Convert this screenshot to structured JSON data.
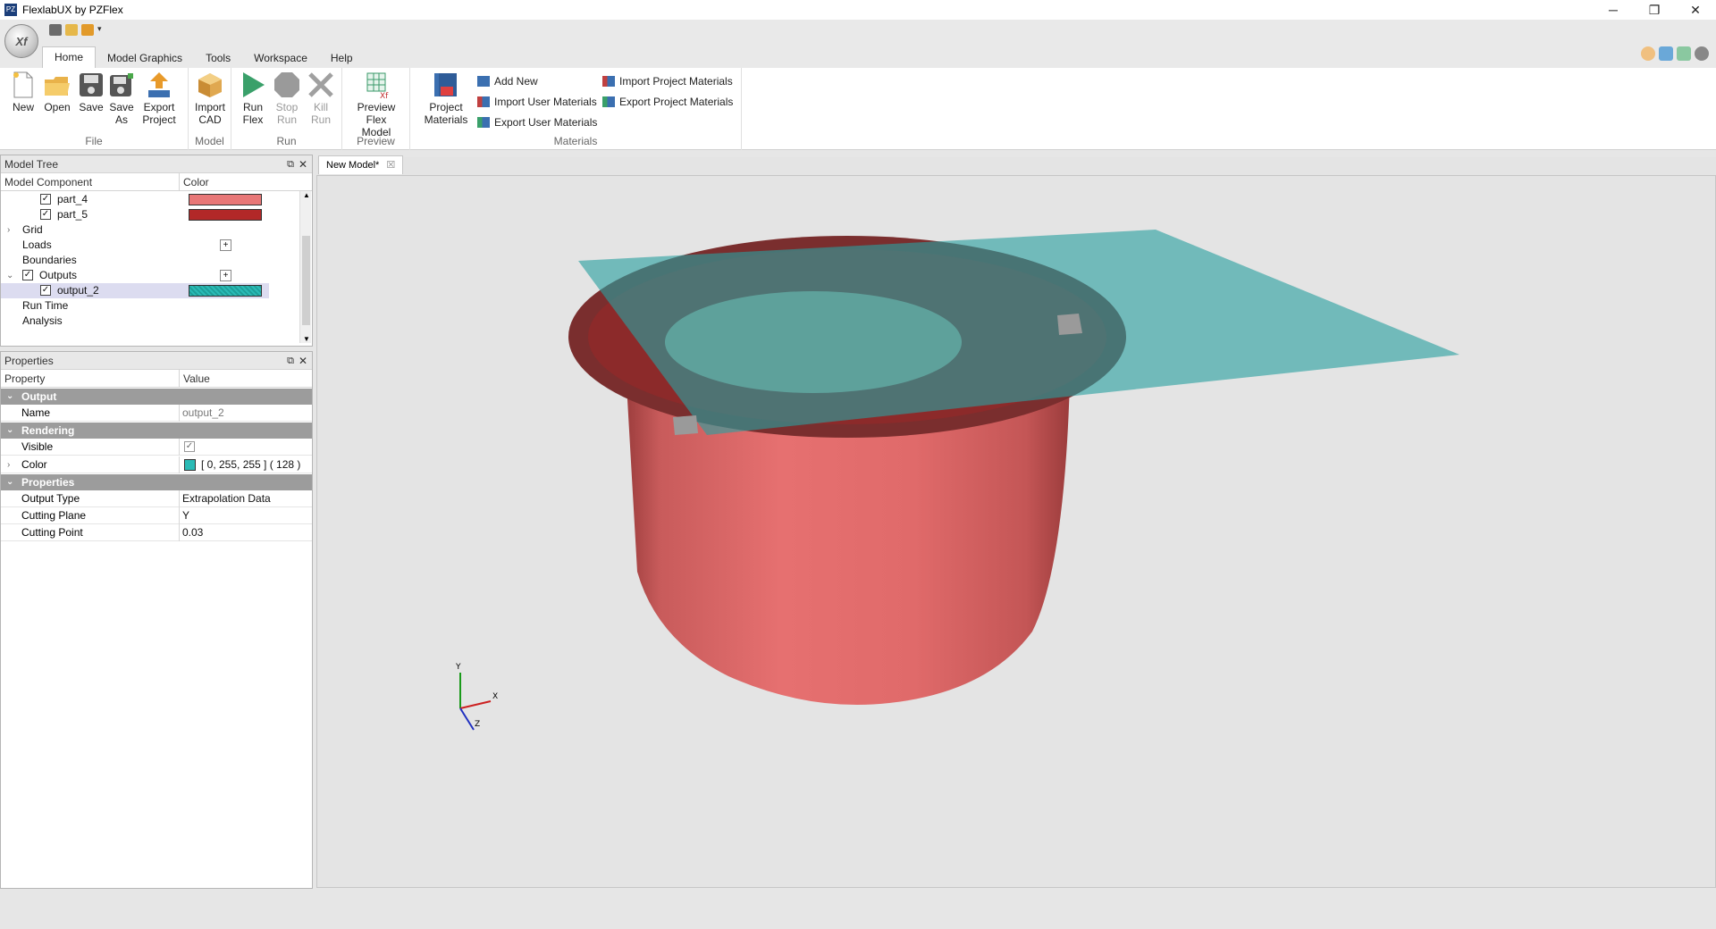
{
  "window": {
    "title": "FlexlabUX by PZFlex",
    "app_icon": "app-icon",
    "minimize": "─",
    "maximize": "❐",
    "close": "✕"
  },
  "app_button_label": "Xf",
  "menu_tabs": [
    "Home",
    "Model Graphics",
    "Tools",
    "Workspace",
    "Help"
  ],
  "active_tab": "Home",
  "ribbon": {
    "file": {
      "label": "File",
      "new": "New",
      "open": "Open",
      "save": "Save",
      "save_as_1": "Save",
      "save_as_2": "As",
      "export_1": "Export",
      "export_2": "Project"
    },
    "model": {
      "label": "Model",
      "import_1": "Import",
      "import_2": "CAD"
    },
    "run": {
      "label": "Run",
      "run_1": "Run",
      "run_2": "Flex",
      "stop_1": "Stop",
      "stop_2": "Run",
      "kill_1": "Kill",
      "kill_2": "Run"
    },
    "preview": {
      "label": "Preview",
      "preview_1": "Preview Flex",
      "preview_2": "Model"
    },
    "materials": {
      "label": "Materials",
      "project_1": "Project",
      "project_2": "Materials",
      "add_new": "Add New",
      "import_user": "Import User Materials",
      "export_user": "Export User Materials",
      "import_project": "Import Project Materials",
      "export_project": "Export Project Materials"
    }
  },
  "model_tree": {
    "title": "Model Tree",
    "col_component": "Model Component",
    "col_color": "Color",
    "items": [
      {
        "label": "part_4",
        "color": "#e87777"
      },
      {
        "label": "part_5",
        "color": "#b22828"
      },
      {
        "label": "Grid"
      },
      {
        "label": "Loads",
        "plus": "+"
      },
      {
        "label": "Boundaries"
      },
      {
        "label": "Outputs",
        "plus": "+"
      },
      {
        "label": "output_2",
        "color": "#2abbb6"
      },
      {
        "label": "Run Time"
      },
      {
        "label": "Analysis"
      }
    ]
  },
  "properties": {
    "title": "Properties",
    "col_property": "Property",
    "col_value": "Value",
    "sections": {
      "output": "Output",
      "rendering": "Rendering",
      "properties": "Properties"
    },
    "rows": {
      "name": {
        "label": "Name",
        "value": "output_2"
      },
      "visible": {
        "label": "Visible",
        "value": "✓"
      },
      "color": {
        "label": "Color",
        "value": "[ 0, 255, 255 ] ( 128 )",
        "swatch": "#2abbb6"
      },
      "output_type": {
        "label": "Output Type",
        "value": "Extrapolation Data"
      },
      "cutting_plane": {
        "label": "Cutting Plane",
        "value": "Y"
      },
      "cutting_point": {
        "label": "Cutting Point",
        "value": "0.03"
      }
    }
  },
  "document_tab": {
    "label": "New Model*",
    "close": "☒"
  },
  "axes": {
    "x": "X",
    "y": "Y",
    "z": "Z"
  },
  "colors": {
    "cylinder": "#d96464",
    "plane": "#2aa0a0",
    "accent": "#1c3f7a"
  }
}
